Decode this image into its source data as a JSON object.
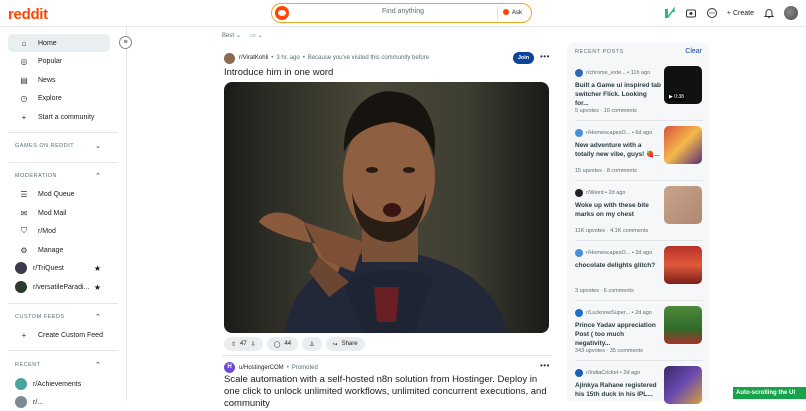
{
  "header": {
    "logo": "reddit",
    "search_placeholder": "Find anything",
    "ask_label": "Ask",
    "create_label": "Create"
  },
  "sidebar": {
    "nav": [
      {
        "label": "Home",
        "icon": "home-icon"
      },
      {
        "label": "Popular",
        "icon": "popular-icon"
      },
      {
        "label": "News",
        "icon": "news-icon"
      },
      {
        "label": "Explore",
        "icon": "explore-icon"
      },
      {
        "label": "Start a community",
        "icon": "plus-icon"
      }
    ],
    "games_title": "GAMES ON REDDIT",
    "moderation_title": "MODERATION",
    "moderation": [
      {
        "label": "Mod Queue"
      },
      {
        "label": "Mod Mail"
      },
      {
        "label": "r/Mod"
      },
      {
        "label": "Manage"
      },
      {
        "label": "r/TriQuest"
      },
      {
        "label": "r/versatileParadi..."
      }
    ],
    "custom_feeds_title": "CUSTOM FEEDS",
    "create_feed": "Create Custom Feed",
    "recent_title": "RECENT",
    "recent": [
      {
        "label": "r/Achievements"
      },
      {
        "label": "r/..."
      }
    ]
  },
  "feed": {
    "sort": "Best",
    "view": "",
    "post1": {
      "subreddit": "r/ViratKohli",
      "time": "3 hr. ago",
      "reason": "Because you've visited this community before",
      "join": "Join",
      "title": "Introduce him in one word",
      "upvotes": "47",
      "comments": "44",
      "share": "Share"
    },
    "post2": {
      "user": "u/HostingerCOM",
      "promoted": "Promoted",
      "title": "Scale automation with a self-hosted n8n solution from Hostinger. Deploy in one click to unlock unlimited workflows, unlimited concurrent executions, and community"
    }
  },
  "recent_posts": {
    "title": "RECENT POSTS",
    "clear": "Clear",
    "items": [
      {
        "sub": "r/chrome_exte...",
        "time": "11h ago",
        "title": "Built a Game ui inspired tab switcher Flick. Looking for...",
        "upvotes": "5 upvotes",
        "comments": "10 comments",
        "duration": "0:38",
        "color": "#2b6cb0"
      },
      {
        "sub": "r/HomescapesO...",
        "time": "6d ago",
        "title": "New adventure with a totally new vibe, guys! 🍓...",
        "upvotes": "15 upvotes",
        "comments": "8 comments",
        "color": "#4a90d9"
      },
      {
        "sub": "r/Weird",
        "time": "2d ago",
        "title": "Woke up with these bite marks on my chest",
        "upvotes": "11K upvotes",
        "comments": "4.1K comments",
        "color": "#222222"
      },
      {
        "sub": "r/HomescapesO...",
        "time": "2d ago",
        "title": "chocolate delights glitch?",
        "upvotes": "3 upvotes",
        "comments": "6 comments",
        "color": "#4a90d9"
      },
      {
        "sub": "r/LucknowSuper...",
        "time": "2d ago",
        "title": "Prince Yadav appreciation Post ( too much negativity...",
        "upvotes": "343 upvotes",
        "comments": "35 comments",
        "color": "#1f6fd1"
      },
      {
        "sub": "r/IndiaCricket",
        "time": "2d ago",
        "title": "Ajinkya Rahane registered his 15th duck in his IPL...",
        "upvotes": "",
        "comments": "",
        "color": "#1a5fb4"
      }
    ]
  },
  "toast": "Auto-scrolling the UI"
}
